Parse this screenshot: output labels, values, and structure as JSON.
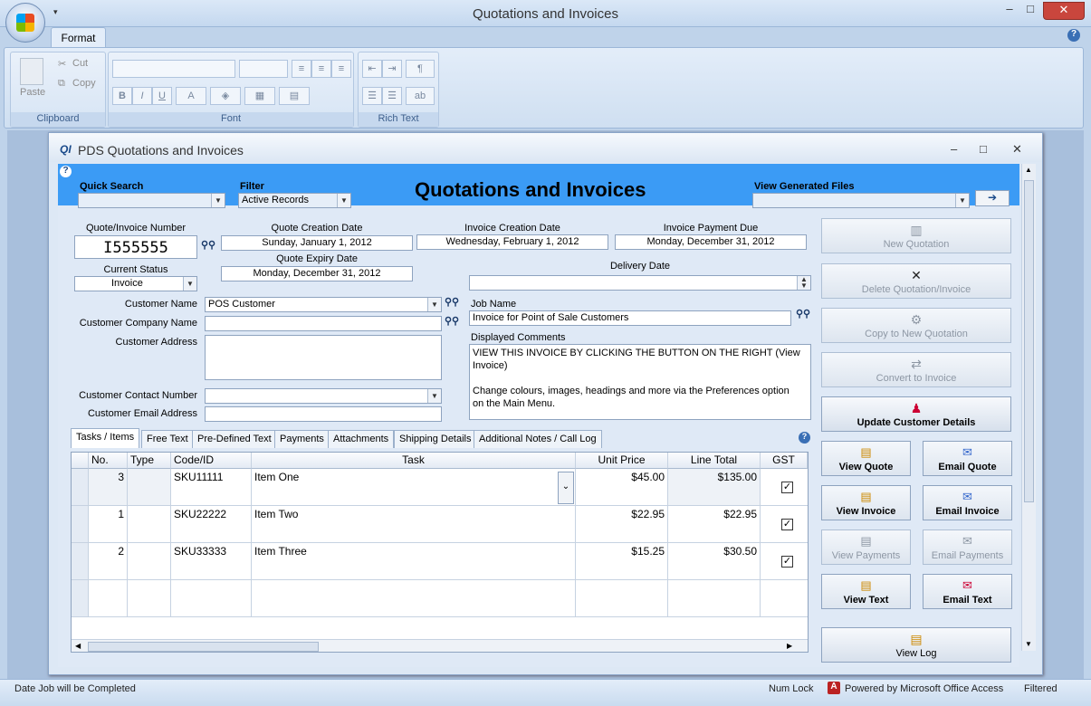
{
  "window": {
    "title": "Quotations and Invoices"
  },
  "ribbon": {
    "tab": "Format",
    "help": "?",
    "clipboard": {
      "label": "Clipboard",
      "paste": "Paste",
      "cut": "Cut",
      "copy": "Copy"
    },
    "font": {
      "label": "Font",
      "bold": "B",
      "italic": "I",
      "underline": "U",
      "font_color": "A"
    },
    "rich_text": {
      "label": "Rich Text"
    }
  },
  "form": {
    "title": "PDS Quotations and Invoices",
    "icon_text": "QI",
    "header": {
      "heading": "Quotations and Invoices",
      "quick_search_label": "Quick Search",
      "quick_search_value": "",
      "filter_label": "Filter",
      "filter_value": "Active Records",
      "view_generated_label": "View Generated Files",
      "view_generated_value": "",
      "go_arrow": "➔",
      "help": "?"
    },
    "fields": {
      "quote_number_label": "Quote/Invoice Number",
      "quote_number": "I555555",
      "quote_creation_label": "Quote Creation Date",
      "quote_creation": "Sunday, January 1, 2012",
      "invoice_creation_label": "Invoice Creation Date",
      "invoice_creation": "Wednesday, February 1, 2012",
      "invoice_payment_label": "Invoice Payment Due",
      "invoice_payment": "Monday, December 31, 2012",
      "quote_expiry_label": "Quote Expiry Date",
      "quote_expiry": "Monday, December 31, 2012",
      "current_status_label": "Current Status",
      "current_status": "Invoice",
      "delivery_date_label": "Delivery Date",
      "delivery_date": "",
      "customer_name_label": "Customer Name",
      "customer_name": "POS Customer",
      "customer_company_label": "Customer Company Name",
      "customer_company": "",
      "customer_address_label": "Customer Address",
      "customer_address": "",
      "customer_contact_label": "Customer Contact Number",
      "customer_contact": "",
      "customer_email_label": "Customer Email Address",
      "customer_email": "",
      "job_name_label": "Job Name",
      "job_name": "Invoice for Point of Sale Customers",
      "comments_label": "Displayed Comments",
      "comments_line1": "VIEW THIS INVOICE BY CLICKING THE BUTTON ON THE RIGHT (View",
      "comments_line2": "Invoice)",
      "comments_line3": "Change colours, images, headings and more via the Preferences option",
      "comments_line4": "on the Main Menu."
    },
    "tabs": [
      "Tasks / Items",
      "Free Text",
      "Pre-Defined Text",
      "Payments",
      "Attachments",
      "Shipping Details",
      "Additional Notes / Call Log"
    ],
    "grid": {
      "columns": [
        "No.",
        "Type",
        "Code/ID",
        "Task",
        "Unit Price",
        "Line Total",
        "GST"
      ],
      "rows": [
        {
          "no": "3",
          "type": "",
          "code": "SKU11111",
          "task": "Item One",
          "unit_price": "$45.00",
          "line_total": "$135.00",
          "gst": "✓"
        },
        {
          "no": "1",
          "type": "",
          "code": "SKU22222",
          "task": "Item Two",
          "unit_price": "$22.95",
          "line_total": "$22.95",
          "gst": "✓"
        },
        {
          "no": "2",
          "type": "",
          "code": "SKU33333",
          "task": "Item Three",
          "unit_price": "$15.25",
          "line_total": "$30.50",
          "gst": "✓"
        }
      ]
    },
    "buttons": {
      "new_quotation": "New Quotation",
      "delete": "Delete Quotation/Invoice",
      "copy": "Copy to New Quotation",
      "convert": "Convert to Invoice",
      "update_customer": "Update Customer Details",
      "view_quote": "View Quote",
      "email_quote": "Email Quote",
      "view_invoice": "View Invoice",
      "email_invoice": "Email Invoice",
      "view_payments": "View Payments",
      "email_payments": "Email Payments",
      "view_text": "View Text",
      "email_text": "Email Text",
      "view_log": "View Log"
    }
  },
  "status": {
    "left": "Date Job will be Completed",
    "num_lock": "Num Lock",
    "powered": "Powered by Microsoft Office Access",
    "filtered": "Filtered"
  }
}
